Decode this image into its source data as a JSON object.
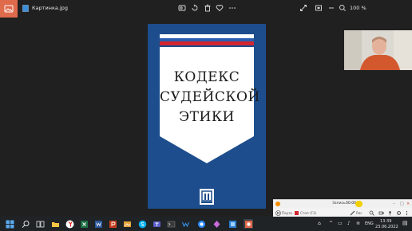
{
  "titlebar": {
    "file_name": "Картинка.jpg",
    "zoom_text": "100 %",
    "tools": [
      {
        "icon": "edit-icon"
      },
      {
        "icon": "rotate-icon"
      },
      {
        "icon": "delete-icon"
      },
      {
        "icon": "favorite-icon"
      },
      {
        "icon": "more-icon"
      }
    ],
    "right_tools": [
      {
        "icon": "fullscreen-icon"
      },
      {
        "icon": "fit-icon"
      },
      {
        "icon": "zoom-out-icon"
      },
      {
        "icon": "zoom-in-icon"
      }
    ]
  },
  "book_cover": {
    "title_lines": [
      "КОДЕКС",
      "СУДЕЙСКОЙ",
      "ЭТИКИ"
    ],
    "colors": {
      "background": "#1d4d8c",
      "flag_white": "#ffffff",
      "flag_blue": "#2a5fb0",
      "flag_red": "#d22630"
    }
  },
  "recorder": {
    "record_label": "Запись",
    "time": "00:00",
    "pause_label": "Пауза",
    "stop_label": "Стоп (F3)",
    "draw_label": "Рис"
  },
  "taskbar": {
    "apps": [
      "start-icon",
      "search-icon",
      "task-view-icon",
      "explorer-icon",
      "yandex-browser-icon",
      "excel-icon",
      "word-icon",
      "powerpoint-icon",
      "photos-icon",
      "skype-icon",
      "teams-icon",
      "terminal-icon",
      "settings-icon",
      "app-icon",
      "photo-viewer-icon"
    ],
    "language": "ENG",
    "time": "13:39",
    "date": "23.06.2022"
  }
}
